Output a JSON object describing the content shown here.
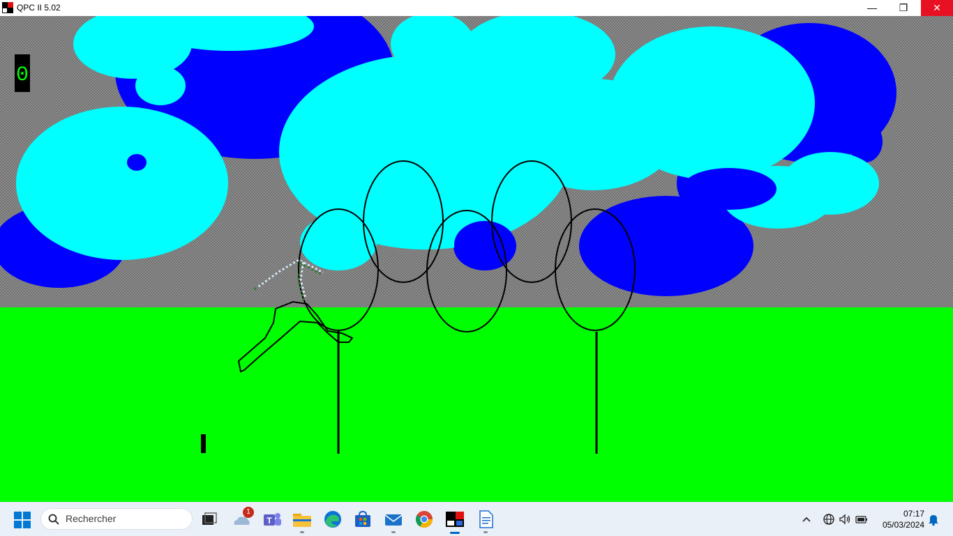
{
  "window": {
    "title": "QPC II 5.02",
    "minimize_label": "—",
    "restore_label": "❐",
    "close_label": "✕"
  },
  "game": {
    "score": "0",
    "colors": {
      "sky": "#808080",
      "ground": "#00ff00",
      "cloud_light": "#00ffff",
      "cloud_dark": "#0000ff",
      "lines": "#000000",
      "score_box": "#000000",
      "score_text": "#00ff00"
    }
  },
  "taskbar": {
    "search_placeholder": "Rechercher",
    "onedrive_badge": "1",
    "time": "07:17",
    "date": "05/03/2024"
  }
}
